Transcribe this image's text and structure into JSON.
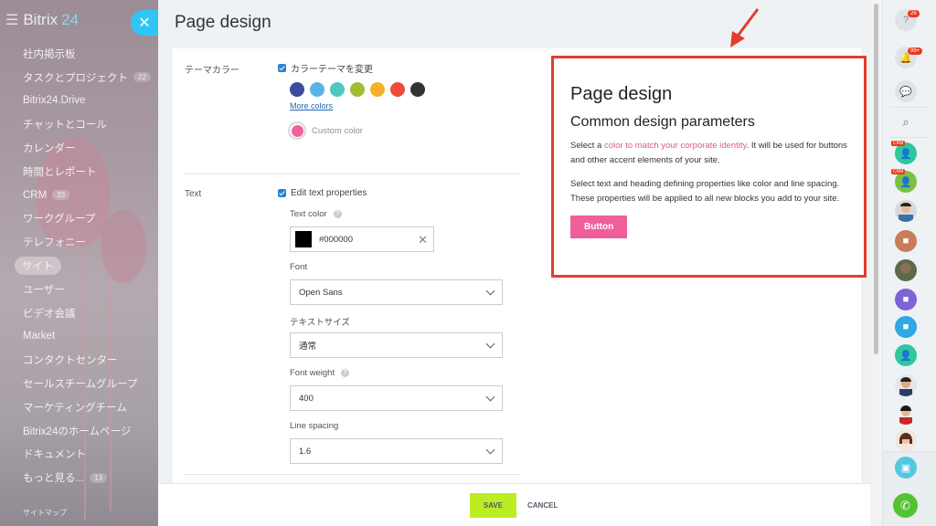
{
  "brand": {
    "name": "Bitrix",
    "num": "24"
  },
  "sidebar": {
    "items": [
      {
        "label": "社内掲示板",
        "count": ""
      },
      {
        "label": "タスクとプロジェクト",
        "count": "22"
      },
      {
        "label": "Bitrix24.Drive",
        "count": ""
      },
      {
        "label": "チャットとコール",
        "count": ""
      },
      {
        "label": "カレンダー",
        "count": ""
      },
      {
        "label": "時間とレポート",
        "count": ""
      },
      {
        "label": "CRM",
        "count": "33"
      },
      {
        "label": "ワークグループ",
        "count": ""
      },
      {
        "label": "テレフォニー",
        "count": ""
      },
      {
        "label": "サイト",
        "count": ""
      },
      {
        "label": "ユーザー",
        "count": ""
      },
      {
        "label": "ビデオ会議",
        "count": ""
      },
      {
        "label": "Market",
        "count": ""
      },
      {
        "label": "コンタクトセンター",
        "count": ""
      },
      {
        "label": "セールスチームグループ",
        "count": ""
      },
      {
        "label": "マーケティングチーム",
        "count": ""
      },
      {
        "label": "Bitrix24のホームページ",
        "count": ""
      },
      {
        "label": "ドキュメント",
        "count": ""
      },
      {
        "label": "もっと見る...",
        "count": "13"
      }
    ],
    "sitemap": "サイトマップ"
  },
  "panel": {
    "title": "Page design",
    "theme_label": "テーマカラー",
    "theme_checkbox": "カラーテーマを変更",
    "swatches": [
      "#3e4b9c",
      "#5bb2e8",
      "#4fc8bf",
      "#9dbd34",
      "#f2b02b",
      "#ee4a3b",
      "#333333"
    ],
    "more_colors": "More colors",
    "custom_color": "Custom color",
    "text_label": "Text",
    "text_checkbox": "Edit text properties",
    "text_color_label": "Text color",
    "text_color_value": "#000000",
    "font_label": "Font",
    "font_value": "Open Sans",
    "size_label": "テキストサイズ",
    "size_value": "通常",
    "weight_label": "Font weight",
    "weight_value": "400",
    "spacing_label": "Line spacing",
    "spacing_value": "1.6"
  },
  "preview": {
    "h1": "Page design",
    "h2": "Common design parameters",
    "p1_before": "Select a ",
    "p1_accent": "color to match your corporate identity",
    "p1_after": ". It will be used for buttons and other accent elements of your site.",
    "p2": "Select text and heading defining properties like color and line spacing. These properties will be applied to all new blocks you add to your site.",
    "button": "Button"
  },
  "footer": {
    "save": "SAVE",
    "cancel": "CANCEL"
  },
  "right_bar": {
    "help_badge": "26",
    "notify_badge": "99+",
    "crm_tag": "CRM"
  }
}
